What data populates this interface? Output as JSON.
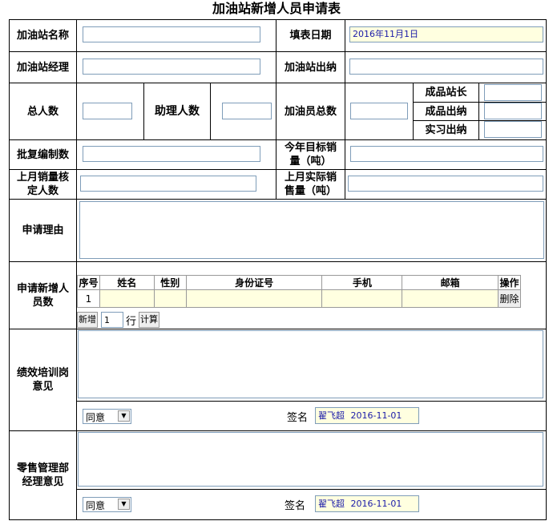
{
  "title": "加油站新增人员申请表",
  "labels": {
    "station_name": "加油站名称",
    "fill_date": "填表日期",
    "station_manager": "加油站经理",
    "station_cashier": "加油站出纳",
    "total_staff": "总人数",
    "assistant_manager_count": "助理人数",
    "attendant_total": "加油员总数",
    "product_station_head": "成品站长",
    "product_cashier": "成品出纳",
    "intern_cashier": "实习出纳",
    "approved_headcount": "批复编制数",
    "annual_target_sales": "今年目标销量（吨）",
    "last_month_sales_quota": "上月销量核定人数",
    "last_month_actual_sales": "上月实际销售量（吨）",
    "reason": "申请理由",
    "new_staff": "申请新增人员数",
    "performance_opinion": "绩效培训岗意见",
    "retail_manager_opinion": "零售管理部经理意见"
  },
  "fields": {
    "fill_date_value": "2016年11月1日"
  },
  "staff_table": {
    "headers": [
      "序号",
      "姓名",
      "性别",
      "身份证号",
      "手机",
      "邮箱",
      "操作"
    ],
    "rows": [
      {
        "index": "1",
        "delete_label": "删除"
      }
    ],
    "add_label": "新增",
    "rows_count": "1",
    "row_unit": "行",
    "calc_label": "计算"
  },
  "opinions": {
    "performance": {
      "decision": "同意",
      "sign_label": "签名",
      "signer": "翟飞超",
      "date": "2016-11-01"
    },
    "retail": {
      "decision": "同意",
      "sign_label": "签名",
      "signer": "翟飞超",
      "date": "2016-11-01"
    }
  }
}
